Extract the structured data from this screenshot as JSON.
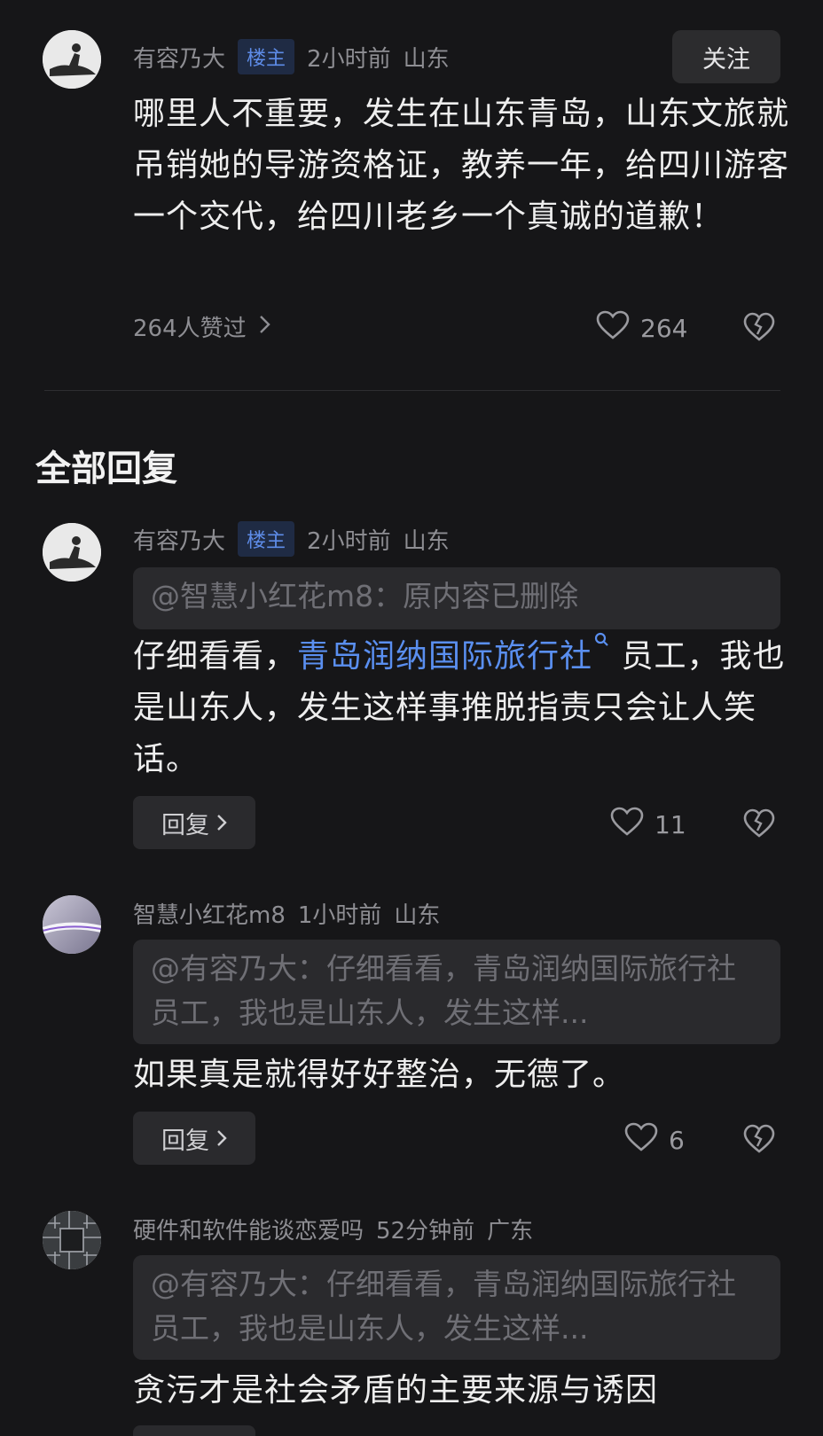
{
  "root_comment": {
    "author": "有容乃大",
    "tag": "楼主",
    "time": "2小时前",
    "location": "山东",
    "follow_label": "关注",
    "text": "哪里人不重要，发生在山东青岛，山东文旅就吊销她的导游资格证，教养一年，给四川游客一个交代，给四川老乡一个真诚的道歉！",
    "liked_by": "264人赞过",
    "like_count": "264"
  },
  "section_title": "全部回复",
  "replies": [
    {
      "author": "有容乃大",
      "tag": "楼主",
      "time": "2小时前",
      "location": "山东",
      "quote": "@智慧小红花m8：原内容已删除",
      "text_before": "仔细看看，",
      "link": "青岛润纳国际旅行社",
      "text_after": " 员工，我也是山东人，发生这样事推脱指责只会让人笑话。",
      "reply_label": "回复",
      "like_count": "11"
    },
    {
      "author": "智慧小红花m8",
      "time": "1小时前",
      "location": "山东",
      "quote": "@有容乃大：仔细看看，青岛润纳国际旅行社员工，我也是山东人，发生这样...",
      "text": "如果真是就得好好整治，无德了。",
      "reply_label": "回复",
      "like_count": "6"
    },
    {
      "author": "硬件和软件能谈恋爱吗",
      "time": "52分钟前",
      "location": "广东",
      "quote": "@有容乃大：仔细看看，青岛润纳国际旅行社员工，我也是山东人，发生这样...",
      "text": "贪污才是社会矛盾的主要来源与诱因"
    }
  ]
}
